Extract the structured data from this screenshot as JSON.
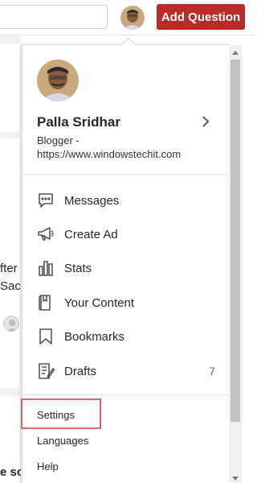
{
  "header": {
    "search_placeholder": "",
    "add_question_label": "Add Question"
  },
  "background": {
    "fragment_1": "fter",
    "fragment_2": "Sach",
    "fragment_3": "e so"
  },
  "profile": {
    "name": "Palla Sridhar",
    "credential_line1": "Blogger -",
    "credential_line2": "https://www.windowstechit.com"
  },
  "menu": {
    "items": [
      {
        "label": "Messages",
        "icon": "messages-icon"
      },
      {
        "label": "Create Ad",
        "icon": "megaphone-icon"
      },
      {
        "label": "Stats",
        "icon": "stats-icon"
      },
      {
        "label": "Your Content",
        "icon": "content-icon"
      },
      {
        "label": "Bookmarks",
        "icon": "bookmark-icon"
      },
      {
        "label": "Drafts",
        "icon": "drafts-icon",
        "count": "7"
      }
    ],
    "secondary": [
      {
        "label": "Settings"
      },
      {
        "label": "Languages"
      },
      {
        "label": "Help"
      }
    ]
  },
  "colors": {
    "brand_red": "#b92b27",
    "highlight": "#e06470"
  }
}
